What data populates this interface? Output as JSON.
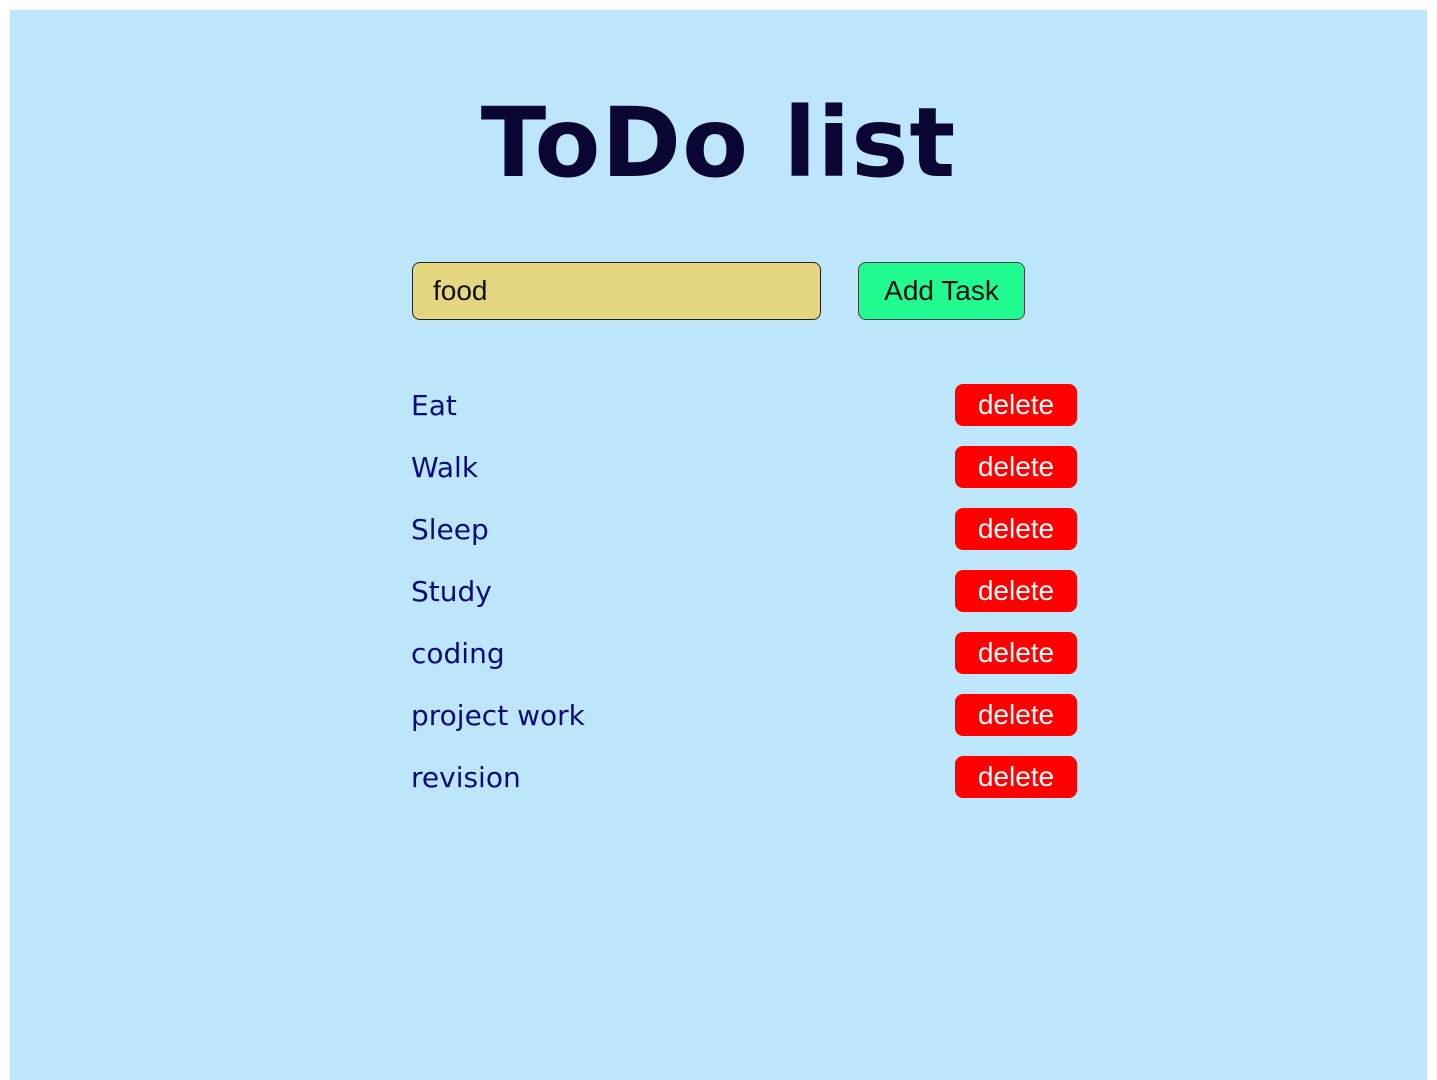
{
  "page": {
    "title": "ToDo list"
  },
  "form": {
    "input_value": "food",
    "add_label": "Add Task"
  },
  "tasks": [
    {
      "text": "Eat",
      "delete_label": "delete"
    },
    {
      "text": "Walk",
      "delete_label": "delete"
    },
    {
      "text": "Sleep",
      "delete_label": "delete"
    },
    {
      "text": "Study",
      "delete_label": "delete"
    },
    {
      "text": "coding",
      "delete_label": "delete"
    },
    {
      "text": "project work",
      "delete_label": "delete"
    },
    {
      "text": "revision",
      "delete_label": "delete"
    }
  ],
  "colors": {
    "background": "#bee6fb",
    "title": "#0b0533",
    "input_background": "#e5d681",
    "add_button": "#22fb90",
    "delete_button": "#fe0000",
    "task_text": "#0c0c7a"
  }
}
